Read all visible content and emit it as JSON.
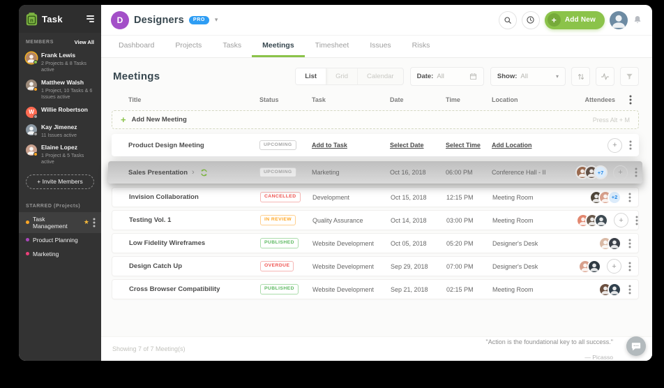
{
  "app": {
    "name": "Task"
  },
  "sidebar": {
    "members_header": "MEMBERS",
    "view_all": "View All",
    "members": [
      {
        "name": "Frank Lewis",
        "detail": "2 Projects & 8 Tasks active",
        "status_color": "#8bc34a",
        "avatar": {
          "type": "photo",
          "color": "#b58563",
          "ring": true
        }
      },
      {
        "name": "Matthew Walsh",
        "detail": "1 Project, 10 Tasks & 6 Issues active",
        "status_color": "#ffa726",
        "avatar": {
          "type": "photo",
          "color": "#9c8a7a",
          "ring": false
        }
      },
      {
        "name": "Willie Robertson",
        "detail": "",
        "status_color": "#9e9e9e",
        "avatar": {
          "type": "letter",
          "letter": "W",
          "color": "#ff6b52",
          "ring": false
        }
      },
      {
        "name": "Kay Jimenez",
        "detail": "11 Issues active",
        "status_color": "#9e9e9e",
        "avatar": {
          "type": "photo",
          "color": "#8d9aa5",
          "ring": false
        }
      },
      {
        "name": "Elaine Lopez",
        "detail": "1 Project & 5 Tasks active",
        "status_color": "#ffa726",
        "avatar": {
          "type": "photo",
          "color": "#caa18e",
          "ring": false
        }
      }
    ],
    "invite_label": "Invite Members",
    "starred_header": "STARRED (Projects)",
    "projects": [
      {
        "name": "Task Management",
        "dot": "#ffa726",
        "starred": true,
        "menu": true,
        "active": true
      },
      {
        "name": "Product Planning",
        "dot": "#ab47bc",
        "starred": false,
        "menu": false,
        "active": false
      },
      {
        "name": "Marketing",
        "dot": "#ec407a",
        "starred": false,
        "menu": false,
        "active": false
      }
    ]
  },
  "topbar": {
    "workspace": "Designers",
    "badge": "PRO",
    "add_new_label": "Add New"
  },
  "tabs": {
    "items": [
      "Dashboard",
      "Projects",
      "Tasks",
      "Meetings",
      "Timesheet",
      "Issues",
      "Risks"
    ],
    "active": "Meetings"
  },
  "toolbar": {
    "title": "Meetings",
    "views": [
      "List",
      "Grid",
      "Calendar"
    ],
    "active_view": "List",
    "date_label": "Date:",
    "date_value": "All",
    "show_label": "Show:",
    "show_value": "All"
  },
  "table": {
    "columns": [
      "Title",
      "Status",
      "Task",
      "Date",
      "Time",
      "Location",
      "Attendees"
    ],
    "add_row": {
      "label": "Add New Meeting",
      "hint": "Press Alt + M"
    },
    "rows": [
      {
        "title": "Product Design Meeting",
        "variant": "draft",
        "status": "UPCOMING",
        "status_type": "upcoming",
        "task_link": "Add to Task",
        "date_link": "Select Date",
        "time_link": "Select Time",
        "location_link": "Add Location",
        "avatars": [],
        "more": null,
        "plus": true
      },
      {
        "title": "Sales Presentation",
        "variant": "selected",
        "has_chevron": true,
        "recurring": true,
        "status": "UPCOMING",
        "status_type": "upcoming",
        "task": "Marketing",
        "date": "Oct 16, 2018",
        "time": "06:00 PM",
        "location": "Conference Hall - II",
        "avatars": [
          "#9a6a4f",
          "#5f4f45"
        ],
        "more": "+7",
        "plus": true
      },
      {
        "title": "Invision Collaboration",
        "variant": "normal",
        "status": "CANCELLED",
        "status_type": "cancelled",
        "task": "Development",
        "date": "Oct 15, 2018",
        "time": "12:15 PM",
        "location": "Meeting Room",
        "avatars": [
          "#4f4639",
          "#d8a08c"
        ],
        "more": "+2",
        "plus": false
      },
      {
        "title": "Testing Vol. 1",
        "variant": "normal",
        "status": "IN REVIEW",
        "status_type": "review",
        "task": "Quality Assurance",
        "date": "Oct 14, 2018",
        "time": "03:00 PM",
        "location": "Meeting Room",
        "avatars": [
          "#e2876f",
          "#6b5b4e",
          "#3e4a52"
        ],
        "more": null,
        "plus": true
      },
      {
        "title": "Low Fidelity Wireframes",
        "variant": "normal",
        "status": "PUBLISHED",
        "status_type": "published",
        "task": "Website Development",
        "date": "Oct 05, 2018",
        "time": "05:20 PM",
        "location": "Designer's Desk",
        "avatars": [
          "#d9b9a5",
          "#3a3f47"
        ],
        "more": null,
        "plus": false
      },
      {
        "title": "Design Catch Up",
        "variant": "normal",
        "status": "OVERDUE",
        "status_type": "overdue",
        "task": "Website Development",
        "date": "Sep 29, 2018",
        "time": "07:00 PM",
        "location": "Designer's Desk",
        "avatars": [
          "#d8a08c",
          "#2f3a42"
        ],
        "more": null,
        "plus": true
      },
      {
        "title": "Cross Browser Compatibility",
        "variant": "normal",
        "status": "PUBLISHED",
        "status_type": "published",
        "task": "Website Development",
        "date": "Sep 21, 2018",
        "time": "02:15 PM",
        "location": "Meeting Room",
        "avatars": [
          "#6b4f3f",
          "#31404d"
        ],
        "more": null,
        "plus": false
      }
    ]
  },
  "footer": {
    "showing": "Showing 7 of 7 Meeting(s)",
    "quote": "\"Action is the foundational key to all success.\"",
    "author": "— Picasso"
  },
  "colors": {
    "accent_green": "#8bc34a",
    "pro_blue": "#2e9df4",
    "workspace_purple": "#a34fc8",
    "badge_cancelled": "#ef5350",
    "badge_review": "#ffa726",
    "badge_published": "#5cb860",
    "badge_overdue": "#ef5350",
    "badge_upcoming": "#a5a5a5",
    "attendee_more_blue": "#1f87e8",
    "sidebar_bg": "#333333"
  }
}
